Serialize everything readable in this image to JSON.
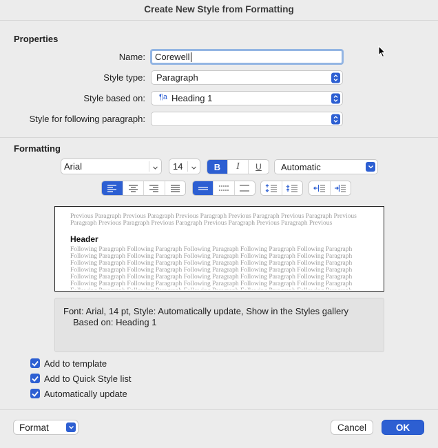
{
  "dialog": {
    "title": "Create New Style from Formatting"
  },
  "properties": {
    "heading": "Properties",
    "name_label": "Name:",
    "name_value": "Corewell",
    "style_type_label": "Style type:",
    "style_type_value": "Paragraph",
    "based_on_label": "Style based on:",
    "based_on_icon": "¶a",
    "based_on_value": "Heading 1",
    "following_label": "Style for following paragraph:",
    "following_value": ""
  },
  "formatting": {
    "heading": "Formatting",
    "font_value": "Arial",
    "size_value": "14",
    "bold_label": "B",
    "italic_label": "I",
    "underline_label": "U",
    "color_value": "Automatic",
    "bold_active": true,
    "align_selected": "left",
    "spacing_selected": "single"
  },
  "preview": {
    "previous_text": "Previous Paragraph Previous Paragraph Previous Paragraph Previous Paragraph Previous Paragraph Previous Paragraph Previous Paragraph Previous Paragraph Previous Paragraph Previous Paragraph Previous Paragraph",
    "header_text": "Header",
    "following_text": "Following Paragraph Following Paragraph Following Paragraph Following Paragraph Following Paragraph Following Paragraph Following Paragraph Following Paragraph Following Paragraph Following Paragraph Following Paragraph Following Paragraph Following Paragraph Following Paragraph Following Paragraph Following Paragraph Following Paragraph Following Paragraph Following Paragraph Following Paragraph Following Paragraph Following Paragraph Following Paragraph Following Paragraph Following Paragraph Following Paragraph Following Paragraph Following Paragraph Following Paragraph Following Paragraph Following Paragraph Following Paragraph Following Paragraph Following Paragraph Following Paragraph Following Paragraph"
  },
  "description": {
    "line1": "Font: Arial, 14 pt, Style: Automatically update, Show in the Styles gallery",
    "line2": "Based on: Heading 1"
  },
  "options": {
    "add_to_template": {
      "label": "Add to template",
      "checked": true
    },
    "add_to_quick_style": {
      "label": "Add to Quick Style list",
      "checked": true
    },
    "auto_update": {
      "label": "Automatically update",
      "checked": true
    }
  },
  "footer": {
    "format_label": "Format",
    "cancel_label": "Cancel",
    "ok_label": "OK"
  },
  "colors": {
    "accent": "#2d5fd2",
    "focus_ring": "#93b5e3",
    "background": "#ececec"
  }
}
